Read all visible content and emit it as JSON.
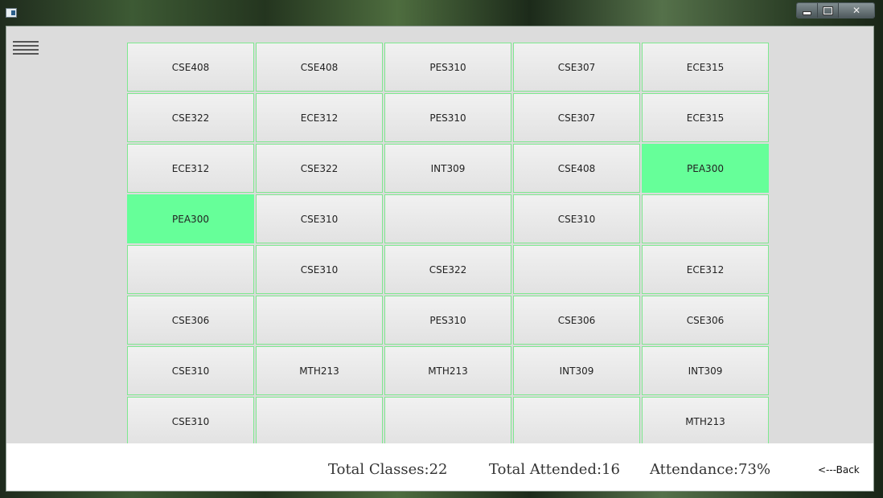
{
  "window": {
    "minimize_glyph": "minimize-icon",
    "maximize_glyph": "maximize-icon",
    "close_label": "✕"
  },
  "menu_icon": "hamburger-menu-icon",
  "grid": {
    "rows": [
      [
        {
          "label": "CSE408",
          "present": false
        },
        {
          "label": "CSE408",
          "present": false
        },
        {
          "label": "PES310",
          "present": false
        },
        {
          "label": "CSE307",
          "present": false
        },
        {
          "label": "ECE315",
          "present": false
        }
      ],
      [
        {
          "label": "CSE322",
          "present": false
        },
        {
          "label": "ECE312",
          "present": false
        },
        {
          "label": "PES310",
          "present": false
        },
        {
          "label": "CSE307",
          "present": false
        },
        {
          "label": "ECE315",
          "present": false
        }
      ],
      [
        {
          "label": "ECE312",
          "present": false
        },
        {
          "label": "CSE322",
          "present": false
        },
        {
          "label": "INT309",
          "present": false
        },
        {
          "label": "CSE408",
          "present": false
        },
        {
          "label": "PEA300",
          "present": true
        }
      ],
      [
        {
          "label": "PEA300",
          "present": true
        },
        {
          "label": "CSE310",
          "present": false
        },
        {
          "label": "",
          "present": false
        },
        {
          "label": "CSE310",
          "present": false
        },
        {
          "label": "",
          "present": false
        }
      ],
      [
        {
          "label": "",
          "present": false
        },
        {
          "label": "CSE310",
          "present": false
        },
        {
          "label": "CSE322",
          "present": false
        },
        {
          "label": "",
          "present": false
        },
        {
          "label": "ECE312",
          "present": false
        }
      ],
      [
        {
          "label": "CSE306",
          "present": false
        },
        {
          "label": "",
          "present": false
        },
        {
          "label": "PES310",
          "present": false
        },
        {
          "label": "CSE306",
          "present": false
        },
        {
          "label": "CSE306",
          "present": false
        }
      ],
      [
        {
          "label": "CSE310",
          "present": false
        },
        {
          "label": "MTH213",
          "present": false
        },
        {
          "label": "MTH213",
          "present": false
        },
        {
          "label": "INT309",
          "present": false
        },
        {
          "label": "INT309",
          "present": false
        }
      ],
      [
        {
          "label": "CSE310",
          "present": false
        },
        {
          "label": "",
          "present": false
        },
        {
          "label": "",
          "present": false
        },
        {
          "label": "",
          "present": false
        },
        {
          "label": "MTH213",
          "present": false
        }
      ]
    ]
  },
  "footer": {
    "total_classes": "Total Classes:22",
    "total_attended": "Total Attended:16",
    "attendance": "Attendance:73%",
    "back_label": "<---Back"
  },
  "colors": {
    "present": "#66ff99",
    "cell_border": "#7ee88f"
  }
}
